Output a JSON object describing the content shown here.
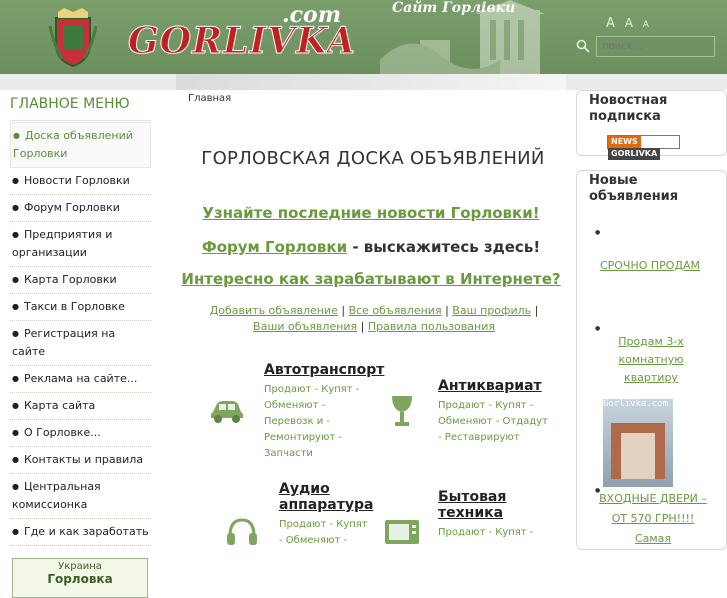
{
  "header": {
    "logo_main": "GORLIVKA",
    "logo_com": ".com",
    "site_title": "Сайт Горлівки",
    "font_sizes": [
      "A",
      "A",
      "A"
    ],
    "search_placeholder": "поиск..."
  },
  "sidebar": {
    "title": "ГЛАВНОЕ МЕНЮ",
    "items": [
      {
        "label": "Доска объявлений Горловки",
        "active": true
      },
      {
        "label": "Новости Горловки"
      },
      {
        "label": "Форум Горловки"
      },
      {
        "label": "Предприятия и организации"
      },
      {
        "label": "Карта Горловки"
      },
      {
        "label": "Такси в Горловке"
      },
      {
        "label": "Регистрация на сайте"
      },
      {
        "label": "Реклама на сайте..."
      },
      {
        "label": "Карта сайта"
      },
      {
        "label": "О Горловке..."
      },
      {
        "label": "Контакты и правила"
      },
      {
        "label": "Центральная комиссионка"
      },
      {
        "label": "Где и как заработать"
      }
    ],
    "region_box": {
      "line1": "Украина",
      "line2": "Горловка"
    }
  },
  "main": {
    "breadcrumb": "Главная",
    "heading": "ГОРЛОВСКАЯ ДОСКА ОБЪЯВЛЕНИЙ",
    "promo1": "Узнайте последние новости Горловки!",
    "promo2_link": "Форум Горловки",
    "promo2_text": " - выскажитесь здесь!",
    "promo3": "Интересно как зарабатывают в Интернете?",
    "links": [
      "Добавить объявление",
      "Все объявления",
      "Ваш профиль",
      "Ваши объявления",
      "Правила пользования"
    ],
    "categories": [
      {
        "title": "Автотранспорт",
        "desc": "Продают - Купят - Обменяют - Перевозк и - Ремонтируют - Запчасти",
        "icon": "car-icon"
      },
      {
        "title": "Антиквариат",
        "desc": "Продают - Купят - Обменяют - Отдадут - Реставрируют",
        "icon": "goblet-icon"
      },
      {
        "title": "Аудио аппаратура",
        "desc": "Продают - Купят - Обменяют -",
        "icon": "headphones-icon"
      },
      {
        "title": "Бытовая техника",
        "desc": "Продают - Купят -",
        "icon": "microwave-icon"
      }
    ]
  },
  "rightbar": {
    "subscribe_title": "Новостная подписка",
    "news_button": [
      "NEWS",
      "GORLIVKA"
    ],
    "ads_title": "Новые объявления",
    "ads": [
      "СРОЧНО ПРОДАМ",
      "Продам 3-х комнатную квартиру",
      "ВХОДНЫЕ ДВЕРИ – ОТ 570 ГРН!!!! Самая"
    ],
    "photo_caption": "Gorlivka.com"
  },
  "colors": {
    "header_bg": "#6f9362",
    "accent_green": "#6a9a3e",
    "logo_red": "#c21f1f"
  }
}
